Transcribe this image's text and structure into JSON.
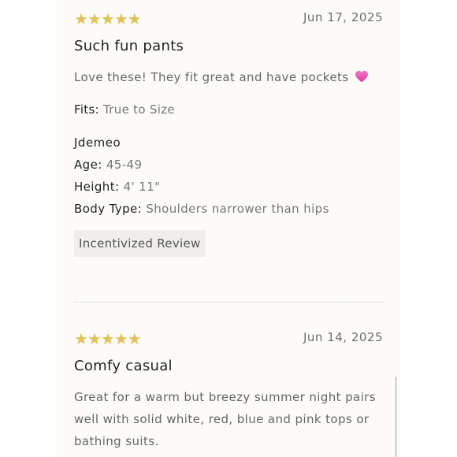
{
  "reviews": [
    {
      "rating": 5,
      "stars": "★★★★★",
      "date": "Jun 17, 2025",
      "title": "Such fun pants",
      "body": "Love these! They fit great and have pockets",
      "body_emoji": "heart-emoji",
      "fits_label": "Fits:",
      "fits_value": "True to Size",
      "reviewer": "Jdemeo",
      "age_label": "Age:",
      "age_value": "45-49",
      "height_label": "Height:",
      "height_value": "4' 11\"",
      "body_type_label": "Body Type:",
      "body_type_value": "Shoulders narrower than hips",
      "badge": "Incentivized Review"
    },
    {
      "rating": 5,
      "stars": "★★★★★",
      "date": "Jun 14, 2025",
      "title": "Comfy casual",
      "body": "Great for a warm but breezy summer night pairs well with solid white, red, blue and pink tops or bathing suits."
    }
  ],
  "colors": {
    "star": "#e2c15a",
    "heart": "#e85ab4",
    "panel_bg": "#fcfbf7",
    "badge_bg": "#f0eeea"
  }
}
